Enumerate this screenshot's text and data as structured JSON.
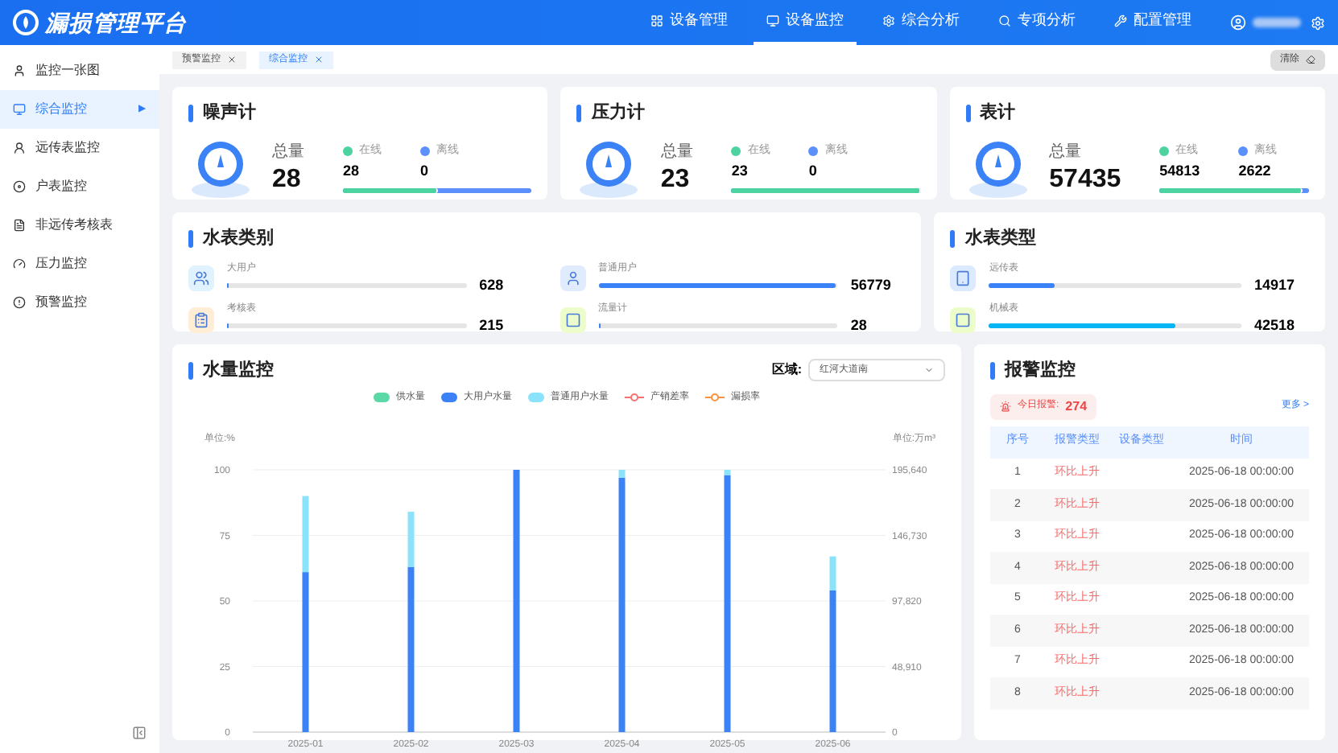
{
  "header": {
    "logo_text": "漏损管理平台",
    "nav": [
      {
        "label": "设备管理",
        "selected": false
      },
      {
        "label": "设备监控",
        "selected": true
      },
      {
        "label": "综合分析",
        "selected": false
      },
      {
        "label": "专项分析",
        "selected": false
      },
      {
        "label": "配置管理",
        "selected": false
      }
    ]
  },
  "sidebar": {
    "items": [
      {
        "label": "监控一张图",
        "selected": false
      },
      {
        "label": "综合监控",
        "selected": true,
        "marker": "▶"
      },
      {
        "label": "远传表监控",
        "selected": false
      },
      {
        "label": "户表监控",
        "selected": false
      },
      {
        "label": "非远传考核表",
        "selected": false
      },
      {
        "label": "压力监控",
        "selected": false
      },
      {
        "label": "预警监控",
        "selected": false
      }
    ]
  },
  "tag_bar": {
    "tags": [
      {
        "label": "预警监控",
        "selected": false
      },
      {
        "label": "综合监控",
        "selected": true
      }
    ],
    "clear_button": "清除"
  },
  "device_cards": [
    {
      "title": "噪声计",
      "total_label": "总量",
      "total": "28",
      "online_label": "在线",
      "online": "28",
      "offline_label": "离线",
      "offline": "0",
      "level": 0.5
    },
    {
      "title": "压力计",
      "total_label": "总量",
      "total": "23",
      "online_label": "在线",
      "online": "23",
      "offline_label": "离线",
      "offline": "0",
      "level": 1
    },
    {
      "title": "表计",
      "total_label": "总量",
      "total": "57435",
      "online_label": "在线",
      "online": "54813",
      "offline_label": "离线",
      "offline": "2622",
      "level": 0.96
    }
  ],
  "meter_category": {
    "title": "水表类别",
    "items": [
      {
        "label": "大用户",
        "value": "628",
        "level": 0.01
      },
      {
        "label": "普通用户",
        "value": "56779",
        "level": 0.99
      },
      {
        "label": "考核表",
        "value": "215",
        "level": 0
      },
      {
        "label": "流量计",
        "value": "28",
        "level": 0
      }
    ]
  },
  "meter_type": {
    "title": "水表类型",
    "items": [
      {
        "label": "远传表",
        "value": "14917",
        "level": 0.26,
        "color": "#3b82f6"
      },
      {
        "label": "机械表",
        "value": "42518",
        "level": 0.74,
        "color": "#06b6f4"
      }
    ]
  },
  "water_monitor": {
    "title": "水量监控",
    "region_label": "区域:",
    "region_value": "红河大道南",
    "chart_data": {
      "type": "bar",
      "stacked": true,
      "grid": true,
      "legend": true,
      "ylabel": "单位:%",
      "y2label": "单位:万m³",
      "categories": [
        "2025-01",
        "2025-02",
        "2025-03",
        "2025-04",
        "2025-05",
        "2025-06"
      ],
      "ylim": [
        0,
        100
      ],
      "yticks": [
        0,
        25,
        50,
        75,
        100
      ],
      "y2ticks": [
        "0",
        "48,910",
        "97,820",
        "146,730",
        "195,640"
      ],
      "series": [
        {
          "name": "供水量",
          "type": "bar",
          "color": "#5ad8a6",
          "values": [
            null,
            null,
            null,
            null,
            null,
            null
          ]
        },
        {
          "name": "大用户水量",
          "type": "bar",
          "color": "#3b82f6",
          "values": [
            61,
            63,
            100,
            97,
            98,
            54
          ]
        },
        {
          "name": "普通用户水量",
          "type": "bar",
          "color": "#8ae3fa",
          "values": [
            29,
            21,
            0,
            3,
            2,
            13
          ]
        },
        {
          "name": "产销差率",
          "type": "line",
          "color": "#f87171",
          "values": [
            null,
            null,
            null,
            null,
            null,
            null
          ]
        },
        {
          "name": "漏损率",
          "type": "line",
          "color": "#fb923c",
          "values": [
            null,
            null,
            null,
            null,
            null,
            null
          ]
        }
      ]
    }
  },
  "alarm_monitor": {
    "title": "报警监控",
    "today_label": "今日报警:",
    "today_count": "274",
    "more_link": "更多 >",
    "columns": [
      "序号",
      "报警类型",
      "设备类型",
      "时间"
    ],
    "rows": [
      {
        "no": "1",
        "type": "环比上升",
        "time": "2025-06-18 00:00:00"
      },
      {
        "no": "2",
        "type": "环比上升",
        "time": "2025-06-18 00:00:00"
      },
      {
        "no": "3",
        "type": "环比上升",
        "time": "2025-06-18 00:00:00"
      },
      {
        "no": "4",
        "type": "环比上升",
        "time": "2025-06-18 00:00:00"
      },
      {
        "no": "5",
        "type": "环比上升",
        "time": "2025-06-18 00:00:00"
      },
      {
        "no": "6",
        "type": "环比上升",
        "time": "2025-06-18 00:00:00"
      },
      {
        "no": "7",
        "type": "环比上升",
        "time": "2025-06-18 00:00:00"
      },
      {
        "no": "8",
        "type": "环比上升",
        "time": "2025-06-18 00:00:00"
      }
    ]
  }
}
